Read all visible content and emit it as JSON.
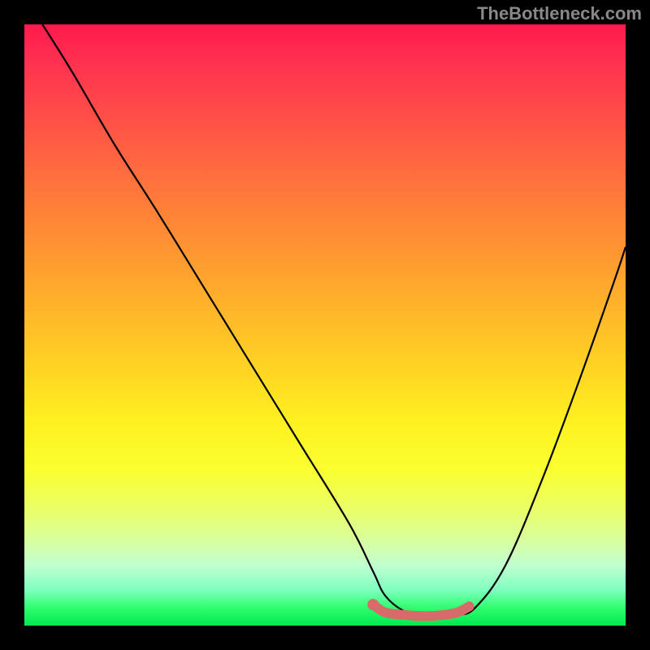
{
  "watermark": "TheBottleneck.com",
  "chart_data": {
    "type": "line",
    "title": "",
    "xlabel": "",
    "ylabel": "",
    "xlim": [
      0,
      100
    ],
    "ylim": [
      0,
      100
    ],
    "series": [
      {
        "name": "bottleneck-curve",
        "x": [
          3,
          8,
          15,
          22,
          30,
          38,
          46,
          54,
          58,
          60,
          63,
          66,
          69,
          72,
          75,
          80,
          86,
          92,
          98,
          100
        ],
        "y": [
          100,
          92,
          80,
          69,
          56,
          43,
          30,
          17,
          9,
          5,
          2.5,
          1.8,
          1.6,
          1.8,
          3,
          10,
          24,
          40,
          57,
          63
        ],
        "color": "#000000"
      },
      {
        "name": "optimal-zone",
        "x": [
          58,
          60,
          63,
          66,
          69,
          72,
          74
        ],
        "y": [
          3.5,
          2.2,
          1.8,
          1.6,
          1.7,
          2.2,
          3.2
        ],
        "color": "#d96a6a"
      }
    ],
    "gradient_stops": [
      {
        "pos": 0,
        "color": "#ff1a4d"
      },
      {
        "pos": 50,
        "color": "#ffaa2c"
      },
      {
        "pos": 70,
        "color": "#fff020"
      },
      {
        "pos": 100,
        "color": "#00e850"
      }
    ]
  }
}
